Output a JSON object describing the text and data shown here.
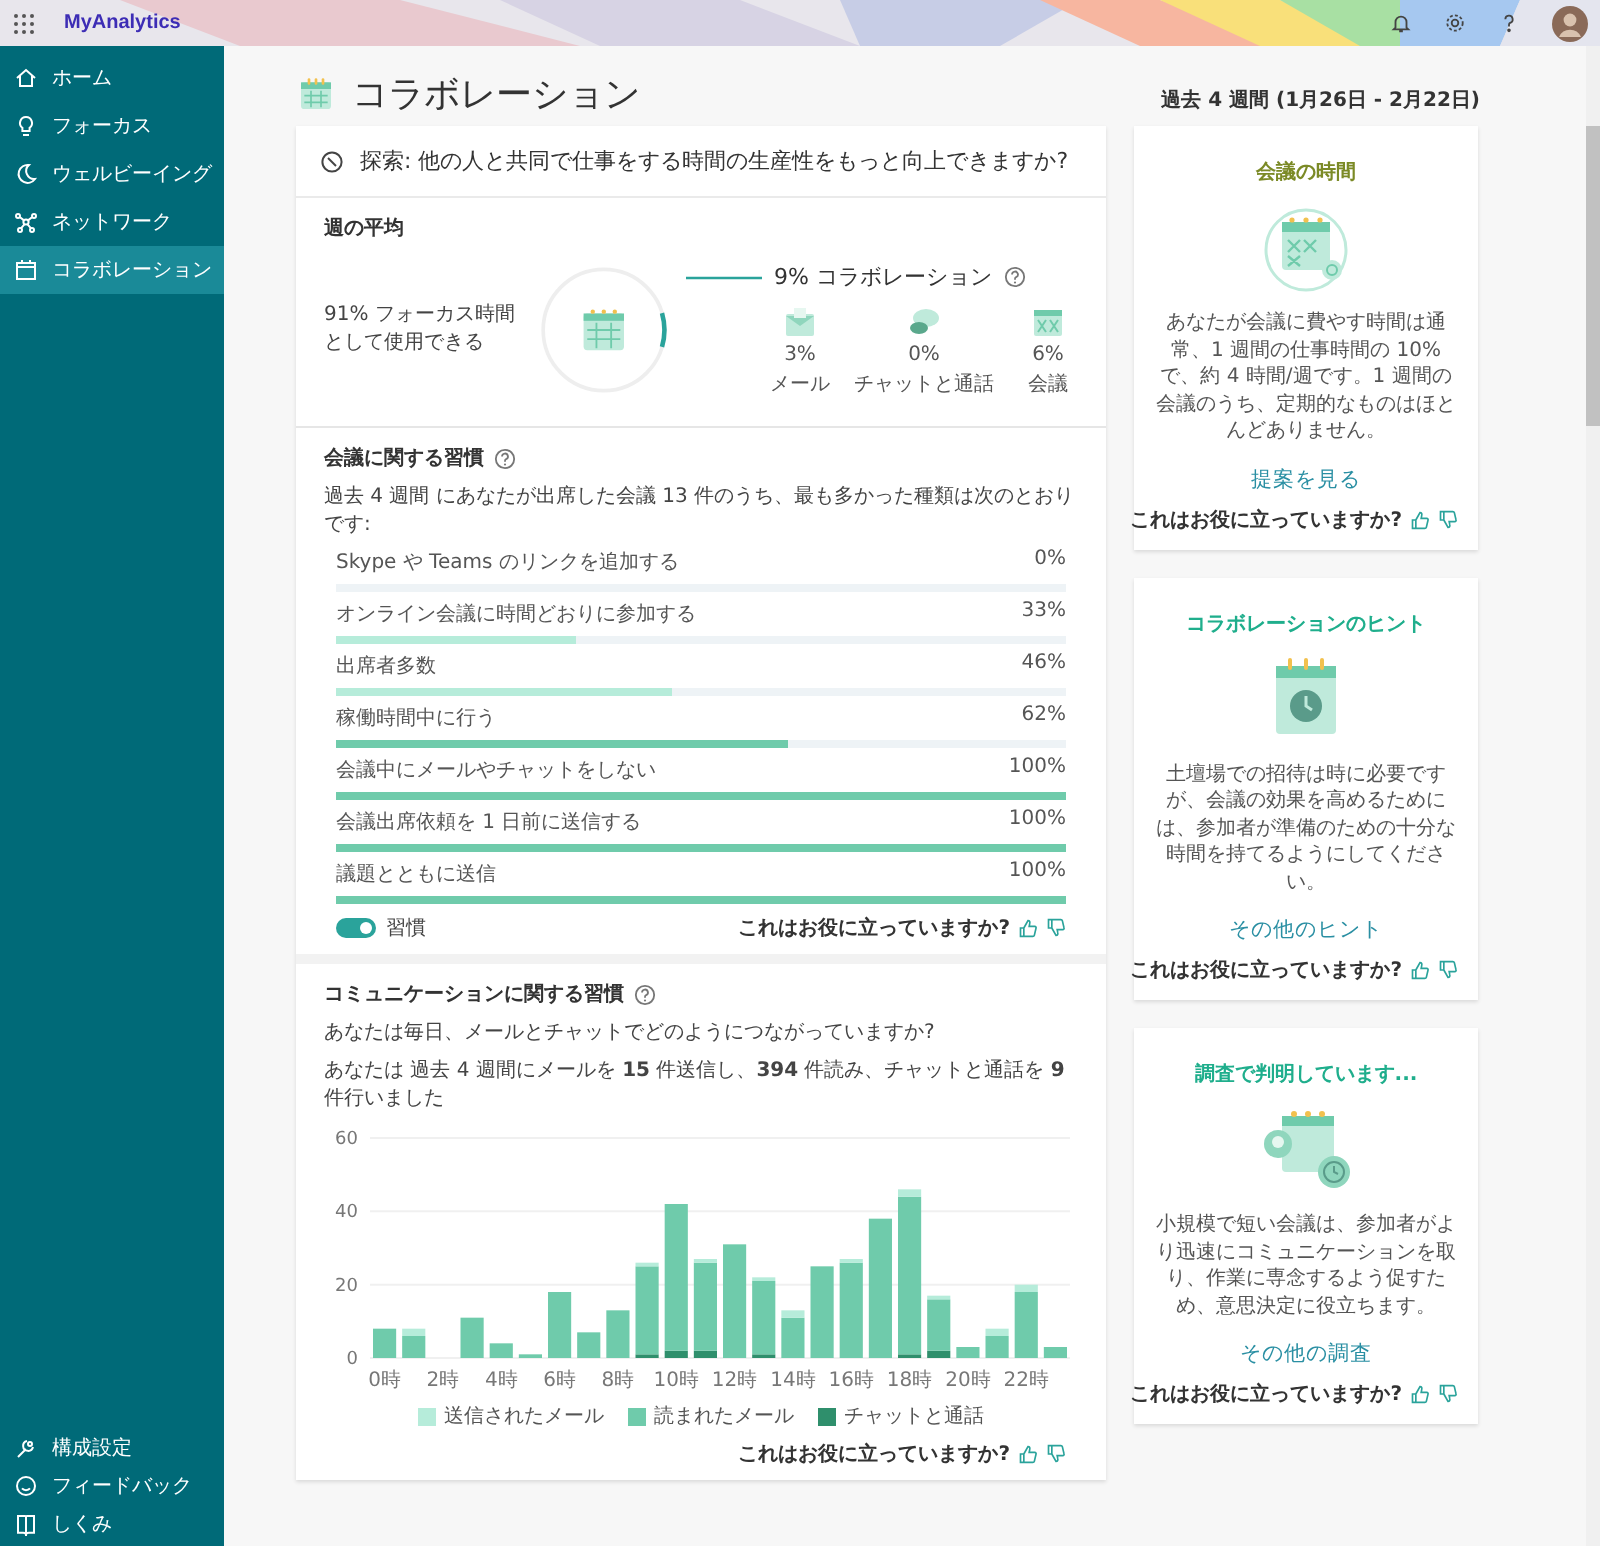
{
  "app": {
    "name": "MyAnalytics"
  },
  "sidebar": {
    "items": [
      {
        "label": "ホーム",
        "selected": false
      },
      {
        "label": "フォーカス",
        "selected": false
      },
      {
        "label": "ウェルビーイング",
        "selected": false
      },
      {
        "label": "ネットワーク",
        "selected": false
      },
      {
        "label": "コラボレーション",
        "selected": true
      }
    ],
    "bottom_items": [
      {
        "label": "構成設定"
      },
      {
        "label": "フィードバック"
      },
      {
        "label": "しくみ"
      }
    ]
  },
  "page": {
    "title": "コラボレーション",
    "period": "過去 4 週間 (1月26日 - 2月22日)"
  },
  "explore": {
    "question": "探索: 他の人と共同で仕事をする時間の生産性をもっと向上できますか?"
  },
  "weekly": {
    "heading": "週の平均",
    "focus_text": "91% フォーカス時間として使用できる",
    "ring": {
      "level": 0.09
    },
    "collab_label": "9% コラボレーション",
    "breakdown": [
      {
        "kind": "mail",
        "value": "3%",
        "label": "メール"
      },
      {
        "kind": "chat",
        "value": "0%",
        "label": "チャットと通話"
      },
      {
        "kind": "meeting",
        "value": "6%",
        "label": "会議"
      }
    ]
  },
  "meeting_habits": {
    "heading": "会議に関する習慣",
    "description": "過去 4 週間 にあなたが出席した会議 13 件のうち、最も多かった種類は次のとおりです:",
    "items": [
      {
        "label": "Skype や Teams のリンクを追加する",
        "reading": "0%",
        "level": 0
      },
      {
        "label": "オンライン会議に時間どおりに参加する",
        "reading": "33%",
        "level": 0.33
      },
      {
        "label": "出席者多数",
        "reading": "46%",
        "level": 0.46
      },
      {
        "label": "稼働時間中に行う",
        "reading": "62%",
        "level": 0.62
      },
      {
        "label": "会議中にメールやチャットをしない",
        "reading": "100%",
        "level": 1
      },
      {
        "label": "会議出席依頼を 1 日前に送信する",
        "reading": "100%",
        "level": 1
      },
      {
        "label": "議題とともに送信",
        "reading": "100%",
        "level": 1
      }
    ],
    "toggle": {
      "label": "習慣",
      "on": true
    },
    "feedback": "これはお役に立っていますか?"
  },
  "communication": {
    "heading": "コミュニケーションに関する習慣",
    "question": "あなたは毎日、メールとチャットでどのようにつながっていますか?",
    "summary": "あなたは 過去 4 週間にメールを **15** 件送信し、**394** 件読み、チャットと通話を **9** 件行いました",
    "chart_data": {
      "type": "bar",
      "stacked": true,
      "x": [
        0,
        1,
        2,
        3,
        4,
        5,
        6,
        7,
        8,
        9,
        10,
        11,
        12,
        13,
        14,
        15,
        16,
        17,
        18,
        19,
        20,
        21,
        22,
        23
      ],
      "xticks": [
        {
          "value": 0,
          "label": "0時"
        },
        {
          "value": 2,
          "label": "2時"
        },
        {
          "value": 4,
          "label": "4時"
        },
        {
          "value": 6,
          "label": "6時"
        },
        {
          "value": 8,
          "label": "8時"
        },
        {
          "value": 10,
          "label": "10時"
        },
        {
          "value": 12,
          "label": "12時"
        },
        {
          "value": 14,
          "label": "14時"
        },
        {
          "value": 16,
          "label": "16時"
        },
        {
          "value": 18,
          "label": "18時"
        },
        {
          "value": 20,
          "label": "20時"
        },
        {
          "value": 22,
          "label": "22時"
        }
      ],
      "xlim": [
        -0.5,
        23.5
      ],
      "ylim": [
        0,
        60
      ],
      "yticks": [
        0,
        20,
        40,
        60
      ],
      "series": [
        {
          "name": "送信されたメール",
          "color": "#b6ecda",
          "values": [
            0,
            2,
            0,
            0,
            0,
            0,
            0,
            0,
            0,
            1,
            0,
            1,
            0,
            1,
            2,
            0,
            1,
            0,
            2,
            1,
            0,
            2,
            2,
            0
          ]
        },
        {
          "name": "読まれたメール",
          "color": "#6fcbab",
          "values": [
            8,
            6,
            0,
            11,
            4,
            1,
            18,
            7,
            13,
            24,
            40,
            24,
            31,
            20,
            11,
            25,
            26,
            38,
            43,
            14,
            3,
            6,
            18,
            3
          ]
        },
        {
          "name": "チャットと通話",
          "color": "#2f8f6c",
          "values": [
            0,
            0,
            0,
            0,
            0,
            0,
            0,
            0,
            0,
            1,
            2,
            2,
            0,
            1,
            0,
            0,
            0,
            0,
            1,
            2,
            0,
            0,
            0,
            0
          ]
        }
      ],
      "legend": true
    },
    "feedback": "これはお役に立っていますか?"
  },
  "cards": [
    {
      "kind": "meeting-time",
      "title": "会議の時間",
      "color": "#7b8a26",
      "text": "あなたが会議に費やす時間は通常、1 週間の仕事時間の 10% で、約 4 時間/週です。1 週間の会議のうち、定期的なものはほとんどありません。",
      "link": "提案を見る",
      "feedback": "これはお役に立っていますか?"
    },
    {
      "kind": "tip",
      "title": "コラボレーションのヒント",
      "color": "#1fae8c",
      "text": "土壇場での招待は時に必要ですが、会議の効果を高めるためには、参加者が準備のための十分な時間を持てるようにしてください。",
      "link": "その他のヒント",
      "feedback": "これはお役に立っていますか?"
    },
    {
      "kind": "research",
      "title": "調査で判明しています...",
      "color": "#1fae8c",
      "text": "小規模で短い会議は、参加者がより迅速にコミュニケーションを取り、作業に専念するよう促すため、意思決定に役立ちます。",
      "link": "その他の調査",
      "feedback": "これはお役に立っていますか?"
    }
  ]
}
